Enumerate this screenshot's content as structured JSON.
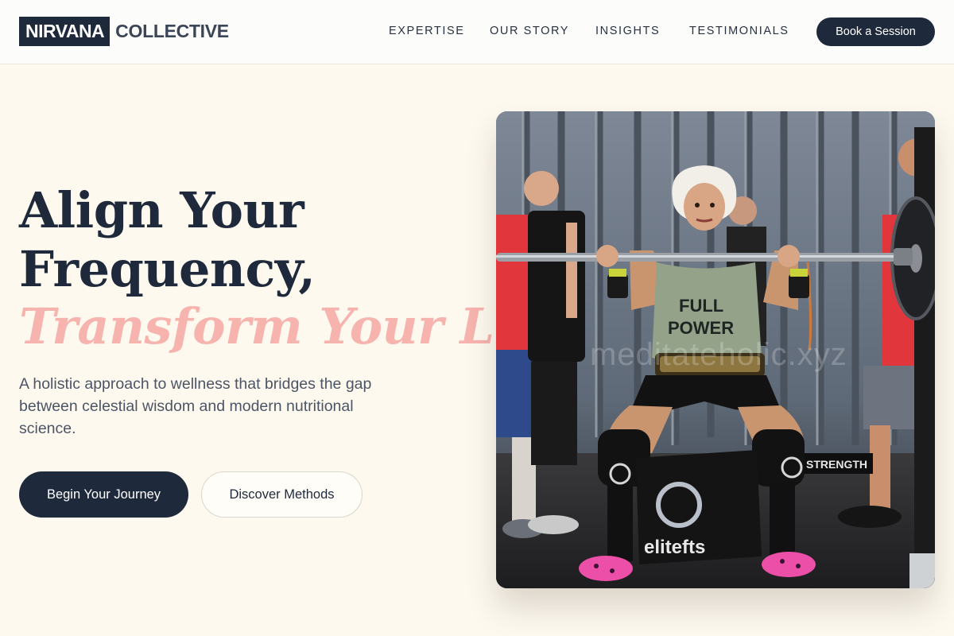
{
  "brand": {
    "primary": "NIRVANA",
    "secondary": "COLLECTIVE",
    "colors": {
      "navy": "#1e293b",
      "cream": "#fef9ef",
      "accent_pink": "#f7b4ae"
    }
  },
  "nav": {
    "items": [
      {
        "label": "EXPERTISE"
      },
      {
        "label": "OUR STORY"
      },
      {
        "label": "INSIGHTS"
      },
      {
        "label": "TESTIMONIALS"
      }
    ],
    "cta_label": "Book a Session"
  },
  "hero": {
    "headline_line1": "Align Your",
    "headline_line2": "Frequency,",
    "headline_accent": "Transform Your Life.",
    "description": "A holistic approach to wellness that bridges the gap between celestial wisdom and modern nutritional science.",
    "primary_button": "Begin Your Journey",
    "secondary_button": "Discover Methods"
  },
  "image": {
    "alt": "Weightlifter in a FULL POWER tank top squatting a loaded barbell in a gym with spotters",
    "watermark": "meditateholic.xyz",
    "shirt_text": "FULL POWER",
    "box_text": "elitefts",
    "plate_text": "STRENGTH"
  }
}
